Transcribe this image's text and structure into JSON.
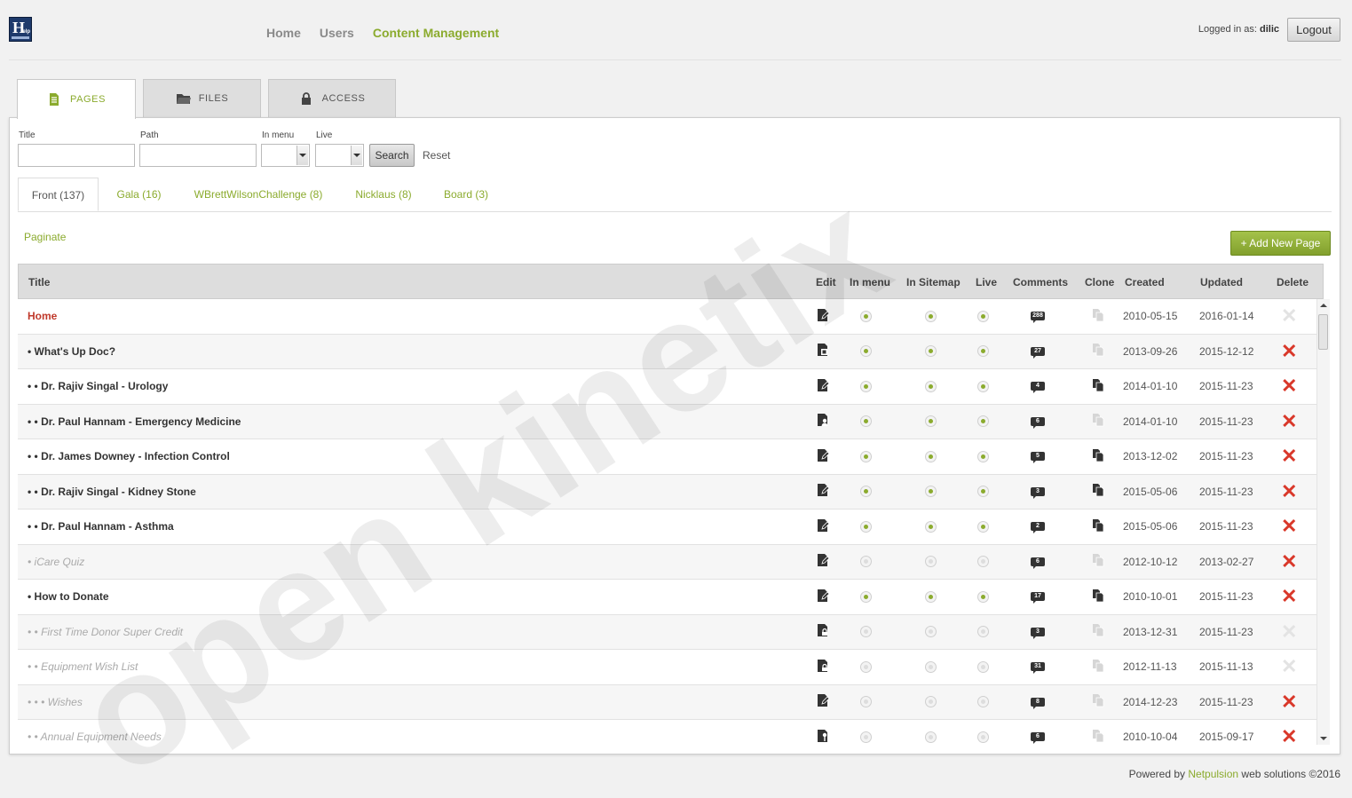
{
  "app": {
    "logo_text": "H",
    "logo_small": "elp",
    "nav": [
      {
        "label": "Home",
        "active": false
      },
      {
        "label": "Users",
        "active": false
      },
      {
        "label": "Content Management",
        "active": true
      }
    ],
    "logged_in_prefix": "Logged in as:",
    "username": "dilic",
    "logout_label": "Logout"
  },
  "main_tabs": [
    {
      "label": "PAGES",
      "icon": "document-icon",
      "active": true
    },
    {
      "label": "FILES",
      "icon": "folder-icon",
      "active": false
    },
    {
      "label": "ACCESS",
      "icon": "lock-icon",
      "active": false
    }
  ],
  "filters": {
    "title_label": "Title",
    "path_label": "Path",
    "in_menu_label": "In menu",
    "live_label": "Live",
    "title_value": "",
    "path_value": "",
    "in_menu_value": "",
    "live_value": "",
    "search_label": "Search",
    "reset_label": "Reset"
  },
  "sub_tabs": [
    {
      "label": "Front (137)",
      "active": true
    },
    {
      "label": "Gala (16)",
      "active": false
    },
    {
      "label": "WBrettWilsonChallenge (8)",
      "active": false
    },
    {
      "label": "Nicklaus (8)",
      "active": false
    },
    {
      "label": "Board (3)",
      "active": false
    }
  ],
  "paginate_label": "Paginate",
  "add_new_label": "+ Add New Page",
  "table": {
    "columns": [
      "Title",
      "Edit",
      "In menu",
      "In Sitemap",
      "Live",
      "Comments",
      "Clone",
      "Created",
      "Updated",
      "Delete"
    ],
    "rows": [
      {
        "title": "Home",
        "style": "home",
        "edit": "edit",
        "in_menu": true,
        "sitemap": true,
        "live": true,
        "comments": "288",
        "clone": false,
        "created": "2010-05-15",
        "updated": "2016-01-14",
        "deletable": false
      },
      {
        "title": "• What's Up Doc?",
        "style": "normal",
        "edit": "page",
        "in_menu": true,
        "sitemap": true,
        "live": true,
        "comments": "27",
        "clone": false,
        "created": "2013-09-26",
        "updated": "2015-12-12",
        "deletable": true
      },
      {
        "title": "• • Dr. Rajiv Singal - Urology",
        "style": "normal",
        "edit": "edit",
        "in_menu": true,
        "sitemap": true,
        "live": true,
        "comments": "4",
        "clone": true,
        "created": "2014-01-10",
        "updated": "2015-11-23",
        "deletable": true
      },
      {
        "title": "• • Dr. Paul Hannam - Emergency Medicine",
        "style": "normal",
        "edit": "user",
        "in_menu": true,
        "sitemap": true,
        "live": true,
        "comments": "6",
        "clone": false,
        "created": "2014-01-10",
        "updated": "2015-11-23",
        "deletable": true
      },
      {
        "title": "• • Dr. James Downey - Infection Control",
        "style": "normal",
        "edit": "edit",
        "in_menu": true,
        "sitemap": true,
        "live": true,
        "comments": "5",
        "clone": true,
        "created": "2013-12-02",
        "updated": "2015-11-23",
        "deletable": true
      },
      {
        "title": "• • Dr. Rajiv Singal - Kidney Stone",
        "style": "normal",
        "edit": "edit",
        "in_menu": true,
        "sitemap": true,
        "live": true,
        "comments": "3",
        "clone": true,
        "created": "2015-05-06",
        "updated": "2015-11-23",
        "deletable": true
      },
      {
        "title": "• • Dr. Paul Hannam - Asthma",
        "style": "normal",
        "edit": "edit",
        "in_menu": true,
        "sitemap": true,
        "live": true,
        "comments": "2",
        "clone": true,
        "created": "2015-05-06",
        "updated": "2015-11-23",
        "deletable": true
      },
      {
        "title": "• iCare Quiz",
        "style": "off",
        "edit": "edit",
        "in_menu": false,
        "sitemap": false,
        "live": false,
        "comments": "6",
        "clone": false,
        "created": "2012-10-12",
        "updated": "2013-02-27",
        "deletable": true
      },
      {
        "title": "• How to Donate",
        "style": "normal",
        "edit": "edit",
        "in_menu": true,
        "sitemap": true,
        "live": true,
        "comments": "17",
        "clone": true,
        "created": "2010-10-01",
        "updated": "2015-11-23",
        "deletable": true
      },
      {
        "title": "• • First Time Donor Super Credit",
        "style": "off",
        "edit": "lock",
        "in_menu": false,
        "sitemap": false,
        "live": false,
        "comments": "3",
        "clone": false,
        "created": "2013-12-31",
        "updated": "2015-11-23",
        "deletable": false
      },
      {
        "title": "• • Equipment Wish List",
        "style": "off",
        "edit": "lock",
        "in_menu": false,
        "sitemap": false,
        "live": false,
        "comments": "31",
        "clone": false,
        "created": "2012-11-13",
        "updated": "2015-11-13",
        "deletable": false
      },
      {
        "title": "• • • Wishes",
        "style": "off",
        "edit": "edit",
        "in_menu": false,
        "sitemap": false,
        "live": false,
        "comments": "8",
        "clone": false,
        "created": "2014-12-23",
        "updated": "2015-11-23",
        "deletable": true
      },
      {
        "title": "• • Annual Equipment Needs",
        "style": "off",
        "edit": "key",
        "in_menu": false,
        "sitemap": false,
        "live": false,
        "comments": "6",
        "clone": false,
        "created": "2010-10-04",
        "updated": "2015-09-17",
        "deletable": true
      }
    ]
  },
  "watermark": "open kinetix",
  "footer": {
    "prefix": "Powered by",
    "brand": "Netpulsion",
    "suffix": "web solutions ©2016"
  },
  "colors": {
    "accent": "#8bab2e",
    "home_title": "#c0392b",
    "delete_active": "#d9382a",
    "delete_disabled": "#e3e3e3"
  }
}
